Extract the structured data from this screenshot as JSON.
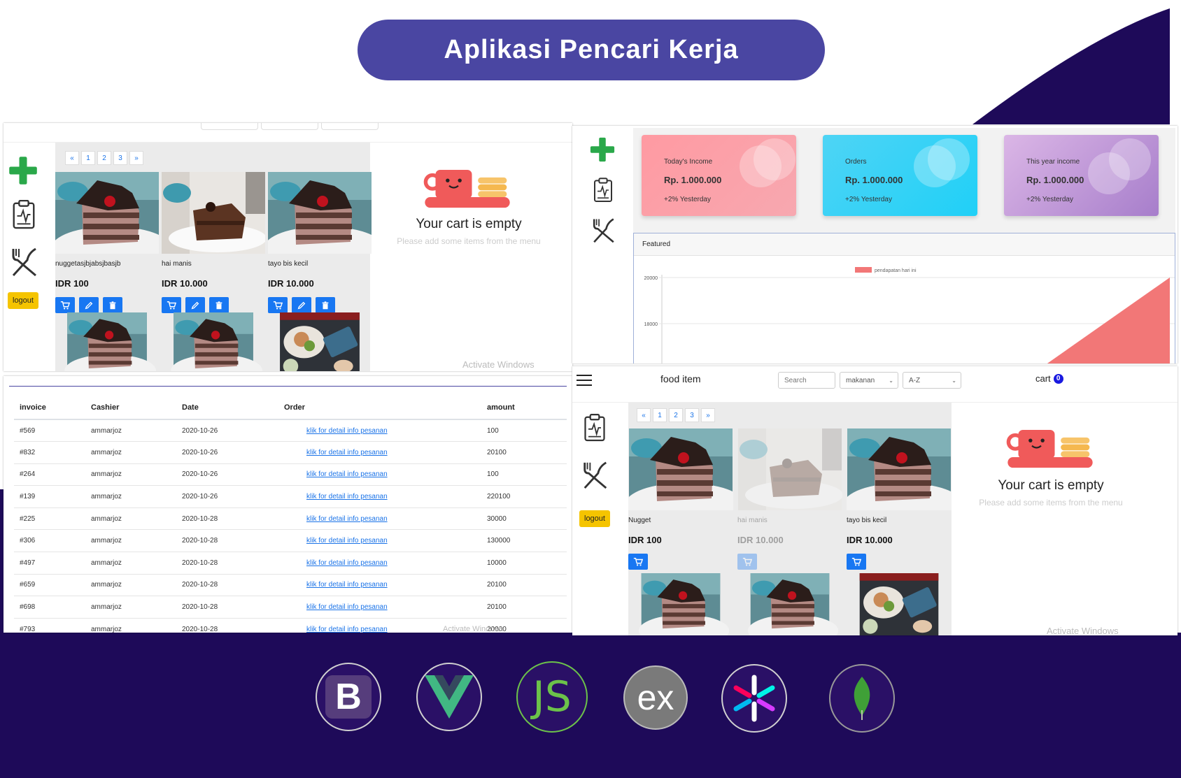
{
  "title": "Aplikasi Pencari Kerja",
  "colors": {
    "navy": "#1e0a59",
    "pill": "#4a46a2",
    "primary": "#1877f2",
    "logout": "#f5c400"
  },
  "shot1": {
    "pager": [
      "«",
      "1",
      "2",
      "3",
      "»"
    ],
    "logout": "logout",
    "items": [
      {
        "name": "nuggetasjbjabsjbasjb",
        "price": "IDR 100"
      },
      {
        "name": "hai manis",
        "price": "IDR 10.000"
      },
      {
        "name": "tayo bis kecil",
        "price": "IDR 10.000"
      }
    ],
    "cart_title": "Your cart is empty",
    "cart_sub": "Please add some items from the menu",
    "watermark": "Activate Windows"
  },
  "shot2": {
    "cards": [
      {
        "label": "Today's Income",
        "value": "Rp. 1.000.000",
        "delta": "+2% Yesterday"
      },
      {
        "label": "Orders",
        "value": "Rp. 1.000.000",
        "delta": "+2% Yesterday"
      },
      {
        "label": "This year income",
        "value": "Rp. 1.000.000",
        "delta": "+2% Yesterday"
      }
    ],
    "featured": "Featured",
    "chart_data": {
      "type": "area",
      "series": [
        {
          "name": "pendapatan hari ini"
        }
      ],
      "yticks": [
        "20000",
        "18000"
      ],
      "legend": "top-center"
    }
  },
  "shot3": {
    "headers": [
      "invoice",
      "Cashier",
      "Date",
      "Order",
      "amount"
    ],
    "link_text": "klik for detail info pesanan",
    "rows": [
      {
        "invoice": "#569",
        "cashier": "ammarjoz",
        "date": "2020-10-26",
        "amount": "100"
      },
      {
        "invoice": "#832",
        "cashier": "ammarjoz",
        "date": "2020-10-26",
        "amount": "20100"
      },
      {
        "invoice": "#264",
        "cashier": "ammarjoz",
        "date": "2020-10-26",
        "amount": "100"
      },
      {
        "invoice": "#139",
        "cashier": "ammarjoz",
        "date": "2020-10-26",
        "amount": "220100"
      },
      {
        "invoice": "#225",
        "cashier": "ammarjoz",
        "date": "2020-10-28",
        "amount": "30000"
      },
      {
        "invoice": "#306",
        "cashier": "ammarjoz",
        "date": "2020-10-28",
        "amount": "130000"
      },
      {
        "invoice": "#497",
        "cashier": "ammarjoz",
        "date": "2020-10-28",
        "amount": "10000"
      },
      {
        "invoice": "#659",
        "cashier": "ammarjoz",
        "date": "2020-10-28",
        "amount": "20100"
      },
      {
        "invoice": "#698",
        "cashier": "ammarjoz",
        "date": "2020-10-28",
        "amount": "20100"
      },
      {
        "invoice": "#793",
        "cashier": "ammarjoz",
        "date": "2020-10-28",
        "amount": "20000"
      }
    ]
  },
  "shot4": {
    "nav_title": "food item",
    "search_placeholder": "Search",
    "category": "makanan",
    "sort": "A-Z",
    "cart_label": "cart",
    "cart_count": "0",
    "pager": [
      "«",
      "1",
      "2",
      "3",
      "»"
    ],
    "logout": "logout",
    "items": [
      {
        "name": "Nugget",
        "price": "IDR 100"
      },
      {
        "name": "hai manis",
        "price": "IDR 10.000"
      },
      {
        "name": "tayo bis kecil",
        "price": "IDR 10.000"
      }
    ],
    "cart_title": "Your cart is empty",
    "cart_sub": "Please add some items from the menu",
    "watermark": "Activate Windows"
  },
  "logos": [
    "bootstrap-logo",
    "vue-logo",
    "nodejs-logo",
    "express-logo",
    "jwt-logo",
    "mongodb-logo"
  ]
}
